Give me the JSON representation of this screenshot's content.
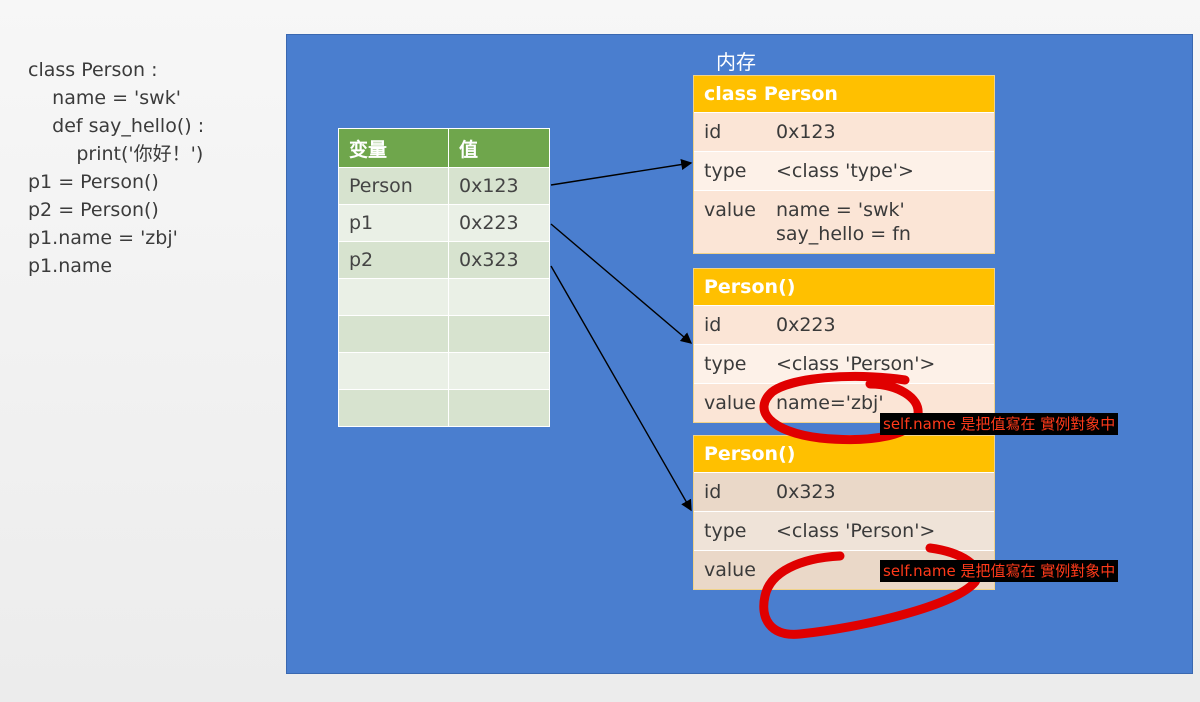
{
  "code": {
    "lines": [
      "class Person :",
      "    name = 'swk'",
      "    def say_hello() :",
      "        print('你好！')",
      "",
      "p1 = Person()",
      "p2 = Person()",
      "",
      "p1.name = 'zbj'",
      "",
      "p1.name"
    ]
  },
  "memory": {
    "title": "内存"
  },
  "variables": {
    "headers": [
      "变量",
      "值"
    ],
    "rows": [
      [
        "Person",
        "0x123"
      ],
      [
        "p1",
        "0x223"
      ],
      [
        "p2",
        "0x323"
      ],
      [
        "",
        ""
      ],
      [
        "",
        ""
      ],
      [
        "",
        ""
      ],
      [
        "",
        ""
      ]
    ]
  },
  "objects": [
    {
      "header": "class Person",
      "id_label": "id",
      "id": "0x123",
      "type_label": "type",
      "type": "<class 'type'>",
      "value_label": "value",
      "value_lines": [
        "name = 'swk'",
        "say_hello = fn"
      ]
    },
    {
      "header": "Person()",
      "id_label": "id",
      "id": "0x223",
      "type_label": "type",
      "type": "<class 'Person'>",
      "value_label": "value",
      "value_lines": [
        "name='zbj'"
      ]
    },
    {
      "header": "Person()",
      "id_label": "id",
      "id": "0x323",
      "type_label": "type",
      "type": "<class 'Person'>",
      "value_label": "value",
      "value_lines": [
        ""
      ]
    }
  ],
  "annotations": {
    "note_1": "self.name 是把值寫在 實例對象中",
    "note_2": "self.name 是把值寫在 實例對象中"
  },
  "colors": {
    "panel": "#4a7ecf",
    "table_header": "#6fa64c",
    "object_header": "#ffc000",
    "ink": "#e00000"
  }
}
